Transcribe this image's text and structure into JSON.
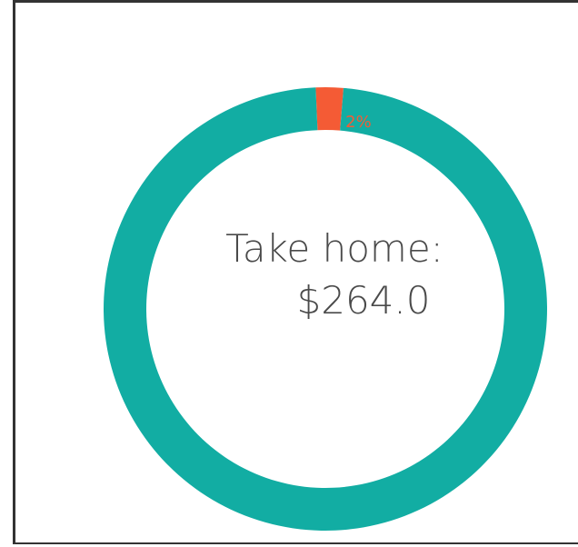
{
  "colors": {
    "take_home": "#12ada3",
    "deduction": "#f45b35",
    "center_text": "#4a4a4a",
    "border": "#333333"
  },
  "center": {
    "line1": "Take home:",
    "line2": "$264.0"
  },
  "chart_data": {
    "type": "pie",
    "style": "donut",
    "title": "",
    "slices": [
      {
        "value": 98,
        "color": "#12ada3",
        "label": ""
      },
      {
        "value": 2,
        "color": "#f45b35",
        "label": "2%"
      }
    ]
  }
}
